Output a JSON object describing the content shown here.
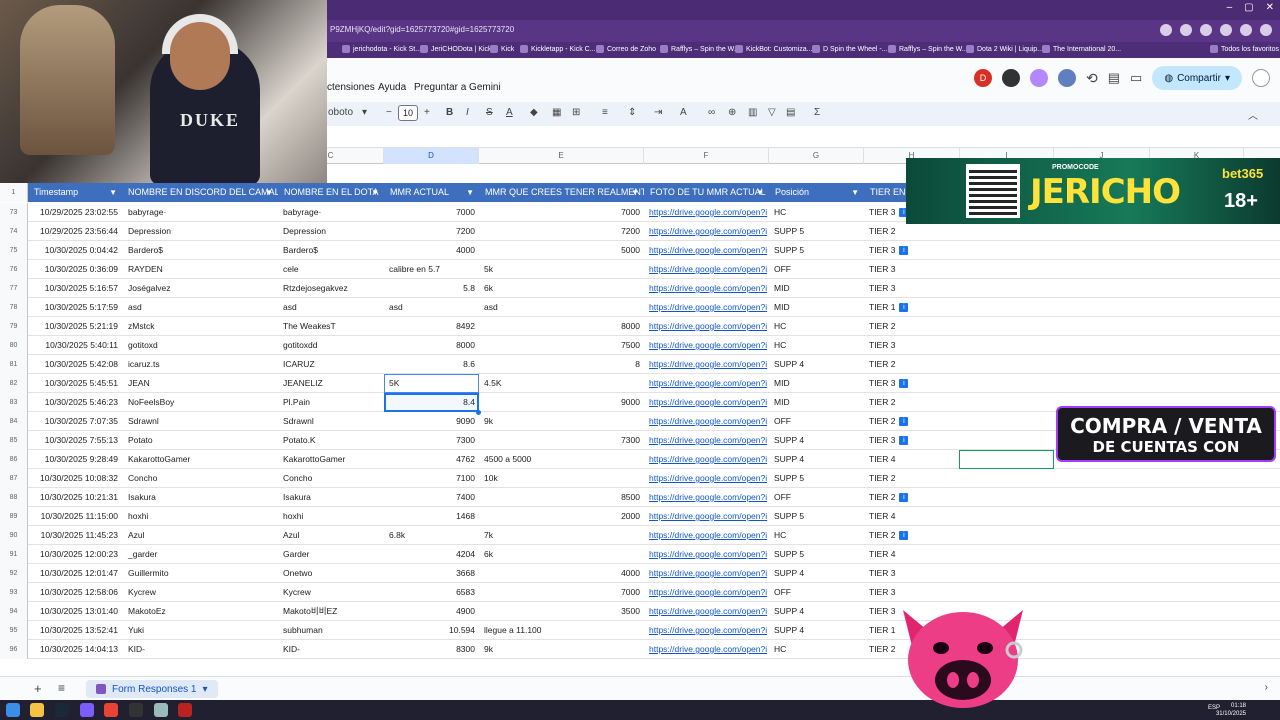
{
  "browser": {
    "url": "P9ZMHjKQ/edit?gid=1625773720#gid=1625773720",
    "bookmarks": [
      "jerichodota - Kick St...",
      "JeriCHODota | Kick",
      "Kick",
      "Kickletapp - Kick C...",
      "Correo de Zoho",
      "Rafflys – Spin the W...",
      "KickBot: Customiza...",
      "D Spin the Wheel -...",
      "Rafflys – Spin the W...",
      "Dota 2 Wiki | Liquip...",
      "The International 20..."
    ],
    "bookmarks_folder": "Todos los favoritos"
  },
  "menu": {
    "items": [
      "ctensiones",
      "Ayuda",
      "Preguntar a Gemini"
    ],
    "avatar_letter": "D",
    "share_label": "Compartir"
  },
  "toolbar": {
    "font": "oboto",
    "font_size": "10",
    "sigma": "Σ"
  },
  "columns": {
    "letters": [
      "C",
      "D",
      "E",
      "F",
      "G",
      "H",
      "I",
      "J",
      "K"
    ]
  },
  "header_row_number": "1",
  "headers": [
    "Timestamp",
    "NOMBRE EN DISCORD DEL CAMAL",
    "NOMBRE EN EL DOTA",
    "MMR ACTUAL",
    "MMR QUE CREES TENER REALMENTE",
    "FOTO DE TU MMR ACTUAL",
    "Posición",
    "TIER EN E"
  ],
  "rows": [
    {
      "n": "73",
      "ts": "10/29/2025 23:02:55",
      "discord": "babyrage·",
      "dota": "babyrage·",
      "mmr": "7000",
      "mmr_num": true,
      "real": "7000",
      "real_num": true,
      "foto": "https://drive.google.com/open?i",
      "pos": "HC",
      "tier": "TIER 3",
      "info": true
    },
    {
      "n": "74",
      "ts": "10/29/2025 23:56:44",
      "discord": "Depression",
      "dota": "Depression",
      "mmr": "7200",
      "mmr_num": true,
      "real": "7200",
      "real_num": true,
      "foto": "https://drive.google.com/open?i",
      "pos": "SUPP 5",
      "tier": "TIER 2",
      "info": false
    },
    {
      "n": "75",
      "ts": "10/30/2025 0:04:42",
      "discord": "Bardero$",
      "dota": "Bardero$",
      "mmr": "4000",
      "mmr_num": true,
      "real": "5000",
      "real_num": true,
      "foto": "https://drive.google.com/open?i",
      "pos": "SUPP 5",
      "tier": "TIER 3",
      "info": true
    },
    {
      "n": "76",
      "ts": "10/30/2025 0:36:09",
      "discord": "RAYDEN",
      "dota": "cele",
      "mmr": "calibre en 5.7",
      "mmr_num": false,
      "real": "5k",
      "real_num": false,
      "foto": "https://drive.google.com/open?i",
      "pos": "OFF",
      "tier": "TIER 3",
      "info": false
    },
    {
      "n": "77",
      "ts": "10/30/2025 5:16:57",
      "discord": "Joségalvez",
      "dota": "Rtzdejosegakvez",
      "mmr": "5.8",
      "mmr_num": true,
      "real": "6k",
      "real_num": false,
      "foto": "https://drive.google.com/open?i",
      "pos": "MID",
      "tier": "TIER 3",
      "info": false
    },
    {
      "n": "78",
      "ts": "10/30/2025 5:17:59",
      "discord": "asd",
      "dota": "asd",
      "mmr": "asd",
      "mmr_num": false,
      "real": "asd",
      "real_num": false,
      "foto": "https://drive.google.com/open?i",
      "pos": "MID",
      "tier": "TIER 1",
      "info": true
    },
    {
      "n": "79",
      "ts": "10/30/2025 5:21:19",
      "discord": "zMstck",
      "dota": "The WeakesT",
      "mmr": "8492",
      "mmr_num": true,
      "real": "8000",
      "real_num": true,
      "foto": "https://drive.google.com/open?i",
      "pos": "HC",
      "tier": "TIER 2",
      "info": false
    },
    {
      "n": "80",
      "ts": "10/30/2025 5:40:11",
      "discord": "gotitoxd",
      "dota": "gotitoxdd",
      "mmr": "8000",
      "mmr_num": true,
      "real": "7500",
      "real_num": true,
      "foto": "https://drive.google.com/open?i",
      "pos": "HC",
      "tier": "TIER 3",
      "info": false
    },
    {
      "n": "81",
      "ts": "10/30/2025 5:42:08",
      "discord": "icaruz.ts",
      "dota": "ICARUZ",
      "mmr": "8.6",
      "mmr_num": true,
      "real": "8",
      "real_num": true,
      "foto": "https://drive.google.com/open?i",
      "pos": "SUPP 4",
      "tier": "TIER 2",
      "info": false
    },
    {
      "n": "82",
      "ts": "10/30/2025 5:45:51",
      "discord": "JEAN",
      "dota": "JEANELIZ",
      "mmr": "5K",
      "mmr_num": false,
      "real": "4.5K",
      "real_num": false,
      "foto": "https://drive.google.com/open?i",
      "pos": "MID",
      "tier": "TIER 3",
      "info": true
    },
    {
      "n": "83",
      "ts": "10/30/2025 5:46:23",
      "discord": "NoFeelsBoy",
      "dota": "Pl.Pain",
      "mmr": "8.4",
      "mmr_num": true,
      "real": "9000",
      "real_num": true,
      "foto": "https://drive.google.com/open?i",
      "pos": "MID",
      "tier": "TIER 2",
      "info": false
    },
    {
      "n": "84",
      "ts": "10/30/2025 7:07:35",
      "discord": "Sdrawnl",
      "dota": "Sdrawnl",
      "mmr": "9090",
      "mmr_num": true,
      "real": "9k",
      "real_num": false,
      "foto": "https://drive.google.com/open?i",
      "pos": "OFF",
      "tier": "TIER 2",
      "info": true
    },
    {
      "n": "85",
      "ts": "10/30/2025 7:55:13",
      "discord": "Potato",
      "dota": "Potato.K",
      "mmr": "7300",
      "mmr_num": true,
      "real": "7300",
      "real_num": true,
      "foto": "https://drive.google.com/open?i",
      "pos": "SUPP 4",
      "tier": "TIER 3",
      "info": true
    },
    {
      "n": "86",
      "ts": "10/30/2025 9:28:49",
      "discord": "KakarottoGamer",
      "dota": "KakarottoGamer",
      "mmr": "4762",
      "mmr_num": true,
      "real": "4500 a 5000",
      "real_num": false,
      "foto": "https://drive.google.com/open?i",
      "pos": "SUPP 4",
      "tier": "TIER 4",
      "info": false
    },
    {
      "n": "87",
      "ts": "10/30/2025 10:08:32",
      "discord": "Concho",
      "dota": "Concho",
      "mmr": "7100",
      "mmr_num": true,
      "real": "10k",
      "real_num": false,
      "foto": "https://drive.google.com/open?i",
      "pos": "SUPP 5",
      "tier": "TIER 2",
      "info": false
    },
    {
      "n": "88",
      "ts": "10/30/2025 10:21:31",
      "discord": "Isakura",
      "dota": "Isakura",
      "mmr": "7400",
      "mmr_num": true,
      "real": "8500",
      "real_num": true,
      "foto": "https://drive.google.com/open?i",
      "pos": "OFF",
      "tier": "TIER 2",
      "info": true
    },
    {
      "n": "89",
      "ts": "10/30/2025 11:15:00",
      "discord": "hoxhi",
      "dota": "hoxhi",
      "mmr": "1468",
      "mmr_num": true,
      "real": "2000",
      "real_num": true,
      "foto": "https://drive.google.com/open?i",
      "pos": "SUPP 5",
      "tier": "TIER 4",
      "info": false
    },
    {
      "n": "90",
      "ts": "10/30/2025 11:45:23",
      "discord": "Azul",
      "dota": "Azul",
      "mmr": "6.8k",
      "mmr_num": false,
      "real": "7k",
      "real_num": false,
      "foto": "https://drive.google.com/open?i",
      "pos": "HC",
      "tier": "TIER 2",
      "info": true
    },
    {
      "n": "91",
      "ts": "10/30/2025 12:00:23",
      "discord": "_garder",
      "dota": "Garder",
      "mmr": "4204",
      "mmr_num": true,
      "real": "6k",
      "real_num": false,
      "foto": "https://drive.google.com/open?i",
      "pos": "SUPP 5",
      "tier": "TIER 4",
      "info": false
    },
    {
      "n": "92",
      "ts": "10/30/2025 12:01:47",
      "discord": "Guillermito",
      "dota": "Onetwo",
      "mmr": "3668",
      "mmr_num": true,
      "real": "4000",
      "real_num": true,
      "foto": "https://drive.google.com/open?i",
      "pos": "SUPP 4",
      "tier": "TIER 3",
      "info": false
    },
    {
      "n": "93",
      "ts": "10/30/2025 12:58:06",
      "discord": "Kycrew",
      "dota": "Kycrew",
      "mmr": "6583",
      "mmr_num": true,
      "real": "7000",
      "real_num": true,
      "foto": "https://drive.google.com/open?i",
      "pos": "OFF",
      "tier": "TIER 3",
      "info": false
    },
    {
      "n": "94",
      "ts": "10/30/2025 13:01:40",
      "discord": "MakotoEz",
      "dota": "Makoto비비EZ",
      "mmr": "4900",
      "mmr_num": true,
      "real": "3500",
      "real_num": true,
      "foto": "https://drive.google.com/open?i",
      "pos": "SUPP 4",
      "tier": "TIER 3",
      "info": false
    },
    {
      "n": "95",
      "ts": "10/30/2025 13:52:41",
      "discord": "Yuki",
      "dota": "subhuman",
      "mmr": "10.594",
      "mmr_num": true,
      "real": "llegue a 11.100",
      "real_num": false,
      "foto": "https://drive.google.com/open?i",
      "pos": "SUPP 4",
      "tier": "TIER 1",
      "info": false
    },
    {
      "n": "96",
      "ts": "10/30/2025 14:04:13",
      "discord": "KID-",
      "dota": "KID-",
      "mmr": "8300",
      "mmr_num": true,
      "real": "9k",
      "real_num": false,
      "foto": "https://drive.google.com/open?i",
      "pos": "HC",
      "tier": "TIER 2",
      "info": false
    }
  ],
  "sheet_tab": "Form Responses 1",
  "overlays": {
    "webcam_shirt": "DUKE",
    "promo_code_label": "PROMOCODE",
    "promo_code": "JERICHO",
    "promo_brand": "bet365",
    "promo_age": "18+",
    "compra_line1": "COMPRA / VENTA",
    "compra_line2": "DE CUENTAS CON"
  },
  "taskbar": {
    "time": "01:18",
    "date": "31/10/2025",
    "lang": "ESP"
  },
  "colors": {
    "header_blue": "#3d6fbe",
    "link": "#1155cc",
    "accent_purple": "#4b2b73"
  }
}
